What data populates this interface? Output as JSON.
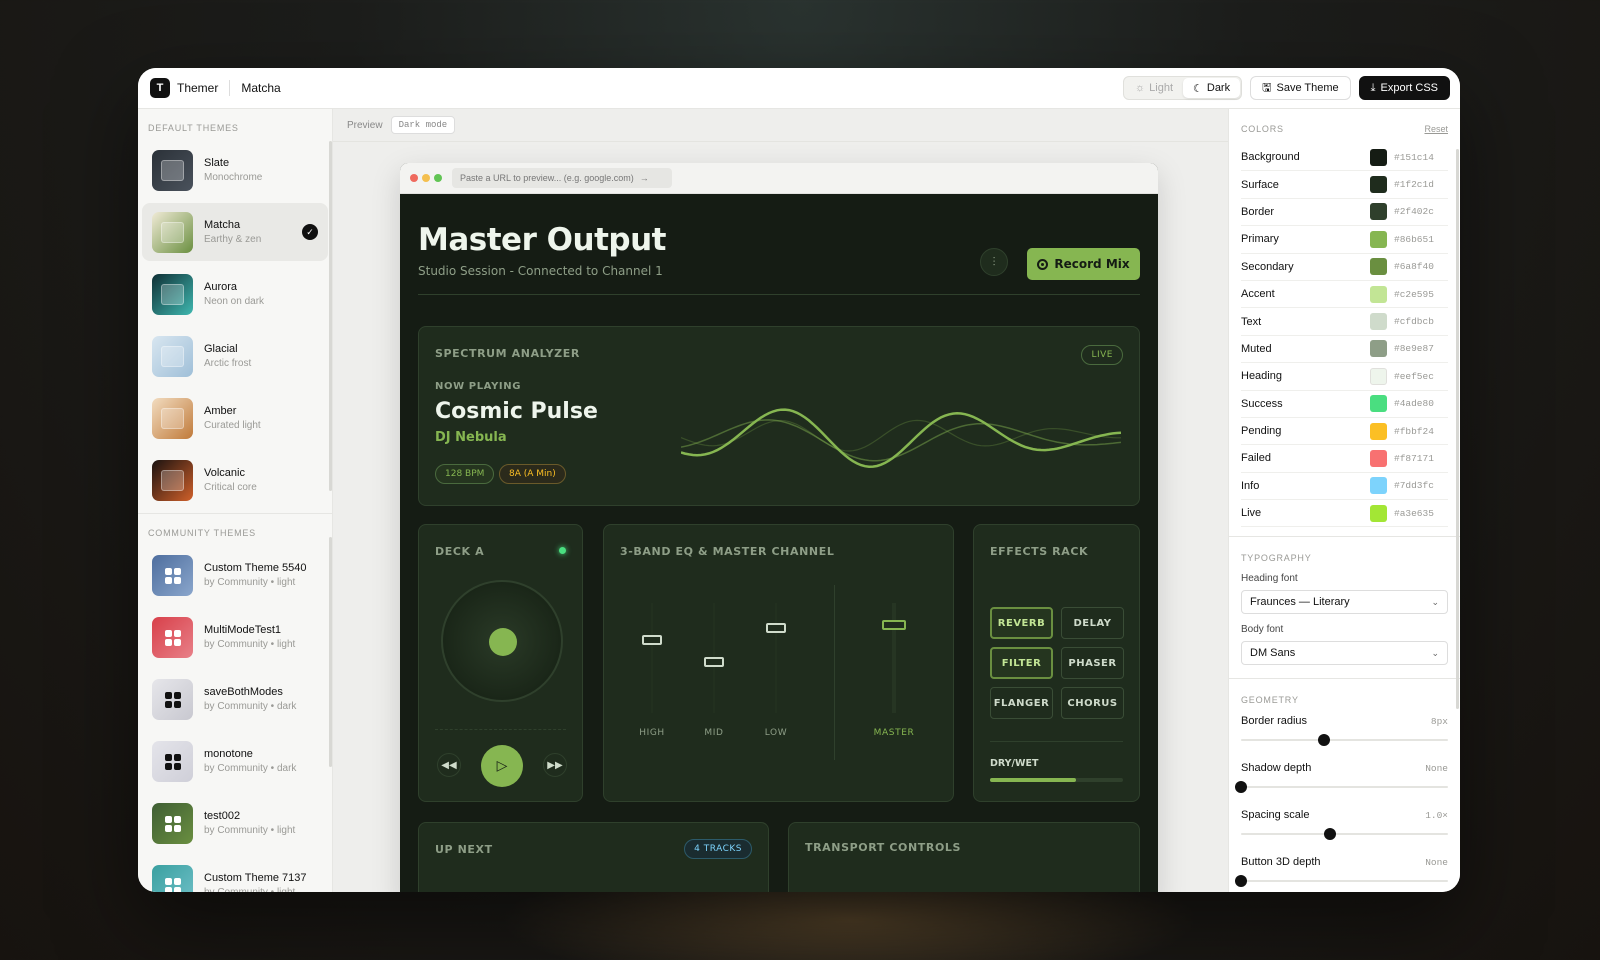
{
  "app": {
    "name": "Themer",
    "logo_letter": "T",
    "current_theme": "Matcha"
  },
  "toolbar": {
    "light_label": "Light",
    "dark_label": "Dark",
    "save_label": "Save Theme",
    "export_label": "Export CSS"
  },
  "sidebar": {
    "default_heading": "DEFAULT THEMES",
    "community_heading": "COMMUNITY THEMES",
    "default_themes": [
      {
        "name": "Slate",
        "sub": "Monochrome",
        "colors": [
          "#2b3138",
          "#4a525c"
        ]
      },
      {
        "name": "Matcha",
        "sub": "Earthy & zen",
        "colors": [
          "#f0ead6",
          "#6a8f40"
        ],
        "selected": true
      },
      {
        "name": "Aurora",
        "sub": "Neon on dark",
        "colors": [
          "#0f2f35",
          "#3fb8b0"
        ]
      },
      {
        "name": "Glacial",
        "sub": "Arctic frost",
        "colors": [
          "#d8e6f0",
          "#9fbfd8"
        ]
      },
      {
        "name": "Amber",
        "sub": "Curated light",
        "colors": [
          "#f2dcc0",
          "#c07a3a"
        ]
      },
      {
        "name": "Volcanic",
        "sub": "Critical core",
        "colors": [
          "#1a1210",
          "#d0602a"
        ]
      }
    ],
    "community_themes": [
      {
        "name": "Custom Theme 5540",
        "sub": "by Community • light",
        "colors": [
          "#4e6e9e",
          "#8aa6cc"
        ]
      },
      {
        "name": "MultiModeTest1",
        "sub": "by Community • light",
        "colors": [
          "#d8404a",
          "#e88088"
        ]
      },
      {
        "name": "saveBothModes",
        "sub": "by Community • dark",
        "colors": [
          "#e6e6ea",
          "#c8c8d0"
        ]
      },
      {
        "name": "monotone",
        "sub": "by Community • dark",
        "colors": [
          "#e4e4ea",
          "#cfcfd8"
        ]
      },
      {
        "name": "test002",
        "sub": "by Community • light",
        "colors": [
          "#3f5e34",
          "#6a8f40"
        ]
      },
      {
        "name": "Custom Theme 7137",
        "sub": "by Community • light",
        "colors": [
          "#3aa0a0",
          "#70c0c8"
        ]
      }
    ]
  },
  "preview": {
    "label": "Preview",
    "mode_pill": "Dark mode",
    "url_placeholder": "Paste a URL to preview... (e.g. google.com)"
  },
  "dashboard": {
    "title": "Master Output",
    "subtitle": "Studio Session - Connected to Channel 1",
    "record_label": "Record Mix",
    "spectrum": {
      "label": "SPECTRUM ANALYZER",
      "badge": "LIVE",
      "now_playing": "NOW PLAYING",
      "track": "Cosmic Pulse",
      "artist": "DJ Nebula",
      "bpm": "128 BPM",
      "key": "8A (A Min)"
    },
    "deck": {
      "label": "DECK A"
    },
    "eq": {
      "label": "3-BAND EQ & MASTER CHANNEL",
      "bands": [
        {
          "name": "HIGH",
          "level": 0.66
        },
        {
          "name": "MID",
          "level": 0.46
        },
        {
          "name": "LOW",
          "level": 0.77
        }
      ],
      "master": {
        "name": "MASTER",
        "level": 0.8
      }
    },
    "effects": {
      "label": "EFFECTS RACK",
      "buttons": [
        {
          "name": "REVERB",
          "active": true
        },
        {
          "name": "DELAY",
          "active": false
        },
        {
          "name": "FILTER",
          "active": true
        },
        {
          "name": "PHASER",
          "active": false
        },
        {
          "name": "FLANGER",
          "active": false
        },
        {
          "name": "CHORUS",
          "active": false
        }
      ],
      "drywet_label": "DRY/WET",
      "drywet": 0.65
    },
    "upnext": {
      "label": "UP NEXT",
      "badge": "4 TRACKS"
    },
    "transport": {
      "label": "TRANSPORT CONTROLS"
    }
  },
  "colors_panel": {
    "heading": "COLORS",
    "reset": "Reset",
    "items": [
      {
        "name": "Background",
        "hex": "#151c14"
      },
      {
        "name": "Surface",
        "hex": "#1f2c1d"
      },
      {
        "name": "Border",
        "hex": "#2f402c"
      },
      {
        "name": "Primary",
        "hex": "#86b651"
      },
      {
        "name": "Secondary",
        "hex": "#6a8f40"
      },
      {
        "name": "Accent",
        "hex": "#c2e595"
      },
      {
        "name": "Text",
        "hex": "#cfdbcb"
      },
      {
        "name": "Muted",
        "hex": "#8e9e87"
      },
      {
        "name": "Heading",
        "hex": "#eef5ec"
      },
      {
        "name": "Success",
        "hex": "#4ade80"
      },
      {
        "name": "Pending",
        "hex": "#fbbf24"
      },
      {
        "name": "Failed",
        "hex": "#f87171"
      },
      {
        "name": "Info",
        "hex": "#7dd3fc"
      },
      {
        "name": "Live",
        "hex": "#a3e635"
      }
    ]
  },
  "typography": {
    "heading": "TYPOGRAPHY",
    "heading_font_label": "Heading font",
    "heading_font": "Fraunces — Literary",
    "body_font_label": "Body font",
    "body_font": "DM Sans"
  },
  "geometry": {
    "heading": "GEOMETRY",
    "items": [
      {
        "name": "Border radius",
        "value": "8px",
        "level": 0.4
      },
      {
        "name": "Shadow depth",
        "value": "None",
        "level": 0
      },
      {
        "name": "Spacing scale",
        "value": "1.0×",
        "level": 0.43
      },
      {
        "name": "Button 3D depth",
        "value": "None",
        "level": 0
      }
    ]
  }
}
